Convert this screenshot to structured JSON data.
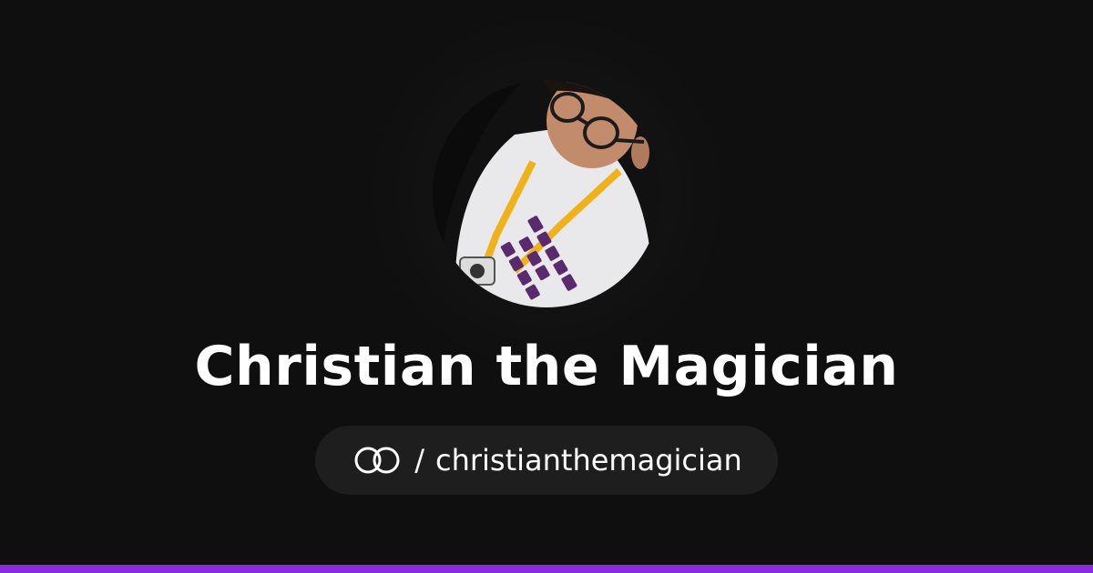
{
  "profile": {
    "display_name": "Christian the Magician",
    "handle_separator": "/",
    "handle": "christianthemagician",
    "logo_icon": "interlocking-rings-icon",
    "avatar": "profile-photo"
  },
  "colors": {
    "background": "#0f0f0f",
    "pill_background": "#1e1e1e",
    "text": "#ffffff",
    "accent": "#8a2be2"
  }
}
